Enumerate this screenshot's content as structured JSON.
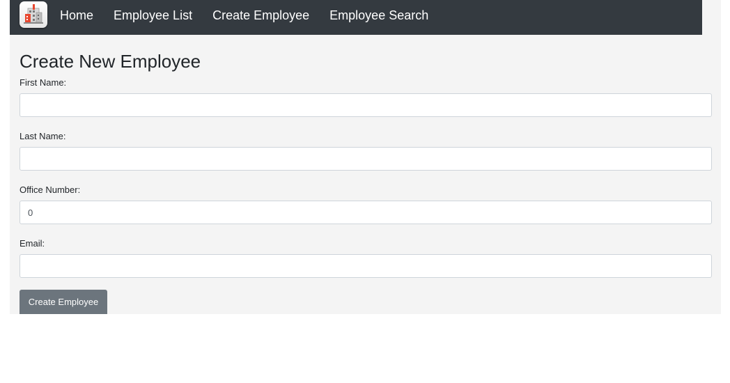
{
  "nav": {
    "logo_icon": "building-app-icon",
    "links": [
      {
        "label": "Home"
      },
      {
        "label": "Employee List"
      },
      {
        "label": "Create Employee"
      },
      {
        "label": "Employee Search"
      }
    ]
  },
  "form": {
    "title": "Create New Employee",
    "fields": [
      {
        "label": "First Name:",
        "value": "",
        "placeholder": ""
      },
      {
        "label": "Last Name:",
        "value": "",
        "placeholder": ""
      },
      {
        "label": "Office Number:",
        "value": "0",
        "placeholder": ""
      },
      {
        "label": "Email:",
        "value": "",
        "placeholder": ""
      }
    ],
    "submit_label": "Create Employee"
  },
  "colors": {
    "navbar": "#343a40",
    "page_background": "#f4f4f4",
    "button": "#6c757d",
    "logo_accent": "#e8472f"
  }
}
